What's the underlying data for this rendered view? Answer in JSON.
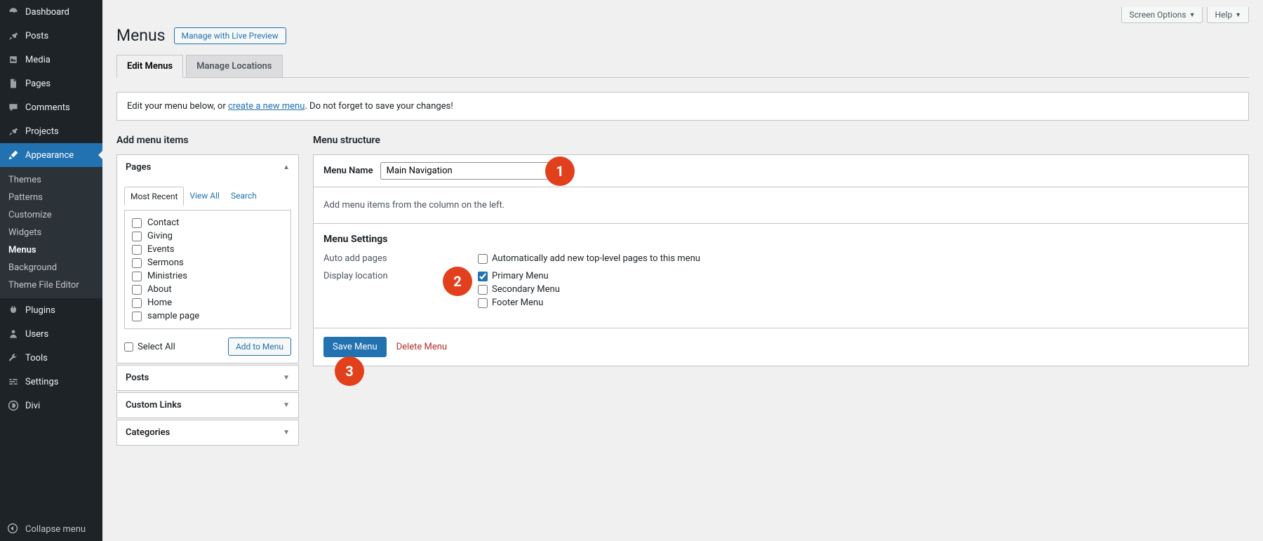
{
  "top": {
    "screen_options": "Screen Options",
    "help": "Help"
  },
  "page": {
    "title": "Menus",
    "live_preview_btn": "Manage with Live Preview"
  },
  "tabs": {
    "edit_menus": "Edit Menus",
    "manage_locations": "Manage Locations"
  },
  "banner": {
    "prefix": "Edit your menu below, or ",
    "link": "create a new menu",
    "suffix": ". Do not forget to save your changes!"
  },
  "sidebar": {
    "items": [
      {
        "label": "Dashboard"
      },
      {
        "label": "Posts"
      },
      {
        "label": "Media"
      },
      {
        "label": "Pages"
      },
      {
        "label": "Comments"
      },
      {
        "label": "Projects"
      },
      {
        "label": "Appearance"
      },
      {
        "label": "Plugins"
      },
      {
        "label": "Users"
      },
      {
        "label": "Tools"
      },
      {
        "label": "Settings"
      },
      {
        "label": "Divi"
      }
    ],
    "sub": [
      {
        "label": "Themes"
      },
      {
        "label": "Patterns"
      },
      {
        "label": "Customize"
      },
      {
        "label": "Widgets"
      },
      {
        "label": "Menus"
      },
      {
        "label": "Background"
      },
      {
        "label": "Theme File Editor"
      }
    ],
    "collapse": "Collapse menu"
  },
  "left_col": {
    "title": "Add menu items",
    "panels": {
      "pages": "Pages",
      "posts": "Posts",
      "custom_links": "Custom Links",
      "categories": "Categories"
    },
    "page_tabs": {
      "most_recent": "Most Recent",
      "view_all": "View All",
      "search": "Search"
    },
    "pages_list": [
      "Contact",
      "Giving",
      "Events",
      "Sermons",
      "Ministries",
      "About",
      "Home",
      "sample page"
    ],
    "select_all": "Select All",
    "add_to_menu": "Add to Menu"
  },
  "right_col": {
    "title": "Menu structure",
    "menu_name_label": "Menu Name",
    "menu_name_value": "Main Navigation",
    "body_text": "Add menu items from the column on the left.",
    "settings_title": "Menu Settings",
    "auto_add_label": "Auto add pages",
    "auto_add_option": "Automatically add new top-level pages to this menu",
    "display_location_label": "Display location",
    "locations": [
      "Primary Menu",
      "Secondary Menu",
      "Footer Menu"
    ],
    "save_btn": "Save Menu",
    "delete_btn": "Delete Menu"
  },
  "callouts": {
    "one": "1",
    "two": "2",
    "three": "3"
  }
}
